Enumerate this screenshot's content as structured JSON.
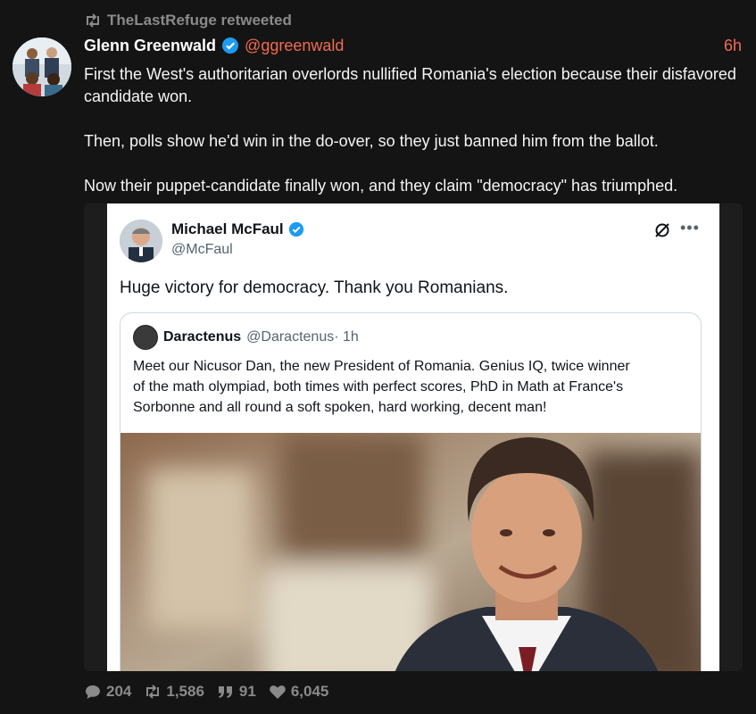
{
  "retweet_banner": {
    "text": "TheLastRefuge retweeted"
  },
  "post": {
    "author_name": "Glenn Greenwald",
    "handle": "@ggreenwald",
    "timestamp": "6h",
    "paragraphs": [
      "First the West's authoritarian overlords nullified Romania's election because their disfavored candidate won.",
      "Then, polls show he'd win in the do-over,  so they just banned him from the ballot.",
      "Now their puppet-candidate finally won, and they claim \"democracy\" has triumphed."
    ]
  },
  "embedded_tweet": {
    "author_name": "Michael McFaul",
    "handle": "@McFaul",
    "text": "Huge victory for democracy. Thank you Romanians.",
    "quoted": {
      "author_name": "Daractenus",
      "handle": "@Daractenus",
      "time": " · 1h",
      "text_lines": [
        "Meet our Nicusor Dan, the new President of Romania. Genius IQ, twice winner",
        "of the math olympiad, both times with perfect scores, PhD in Math at France's",
        "Sorbonne and all round a soft spoken, hard working, decent man!"
      ]
    }
  },
  "actions": {
    "replies": "204",
    "retweets": "1,586",
    "quotes": "91",
    "likes": "6,045"
  },
  "colors": {
    "background": "#141414",
    "accent": "#f26b4f",
    "muted": "#8a8a8a",
    "verified": "#1d9bf0"
  },
  "icons": [
    "retweet-icon",
    "verified-icon",
    "grok-icon",
    "more-icon",
    "reply-icon",
    "quote-icon",
    "like-icon"
  ]
}
